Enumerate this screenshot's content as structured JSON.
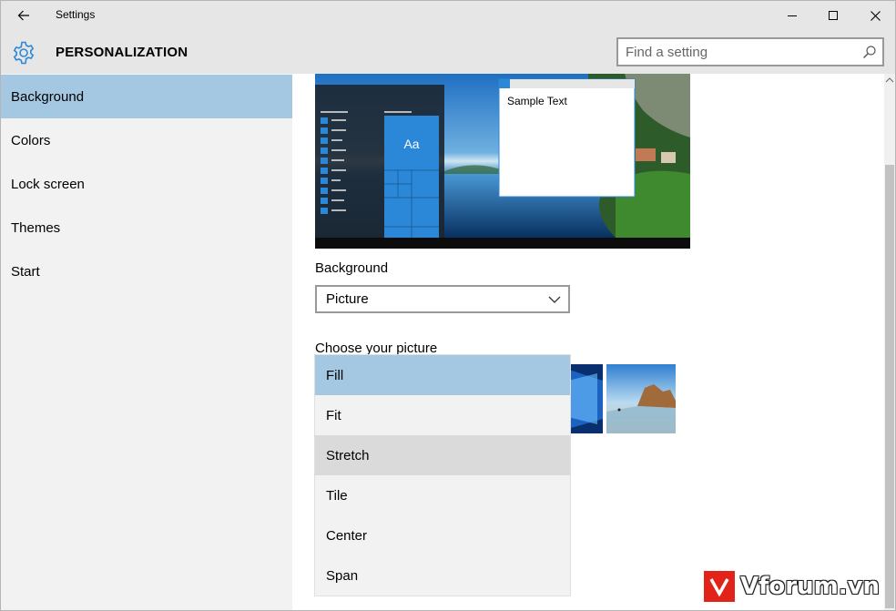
{
  "window": {
    "title": "Settings"
  },
  "header": {
    "section_title": "PERSONALIZATION",
    "search_placeholder": "Find a setting"
  },
  "sidebar": {
    "items": [
      {
        "label": "Background",
        "selected": true
      },
      {
        "label": "Colors"
      },
      {
        "label": "Lock screen"
      },
      {
        "label": "Themes"
      },
      {
        "label": "Start"
      }
    ]
  },
  "preview": {
    "sample_text": "Sample Text",
    "tile_text": "Aa"
  },
  "background": {
    "label": "Background",
    "value": "Picture"
  },
  "choose_picture": {
    "label": "Choose your picture"
  },
  "fit_dropdown": {
    "options": [
      {
        "label": "Fill",
        "selected": true
      },
      {
        "label": "Fit"
      },
      {
        "label": "Stretch",
        "hovered": true
      },
      {
        "label": "Tile"
      },
      {
        "label": "Center"
      },
      {
        "label": "Span"
      }
    ]
  },
  "watermark": {
    "text": "Vforum.vn"
  },
  "colors": {
    "accent": "#2b88d8",
    "selection": "#a4c8e2",
    "sidebar_bg": "#f2f2f2",
    "titlebar_bg": "#e6e6e6"
  },
  "icons": [
    "back-arrow-icon",
    "minimize-icon",
    "maximize-icon",
    "close-icon",
    "gear-icon",
    "search-icon",
    "chevron-down-icon"
  ]
}
